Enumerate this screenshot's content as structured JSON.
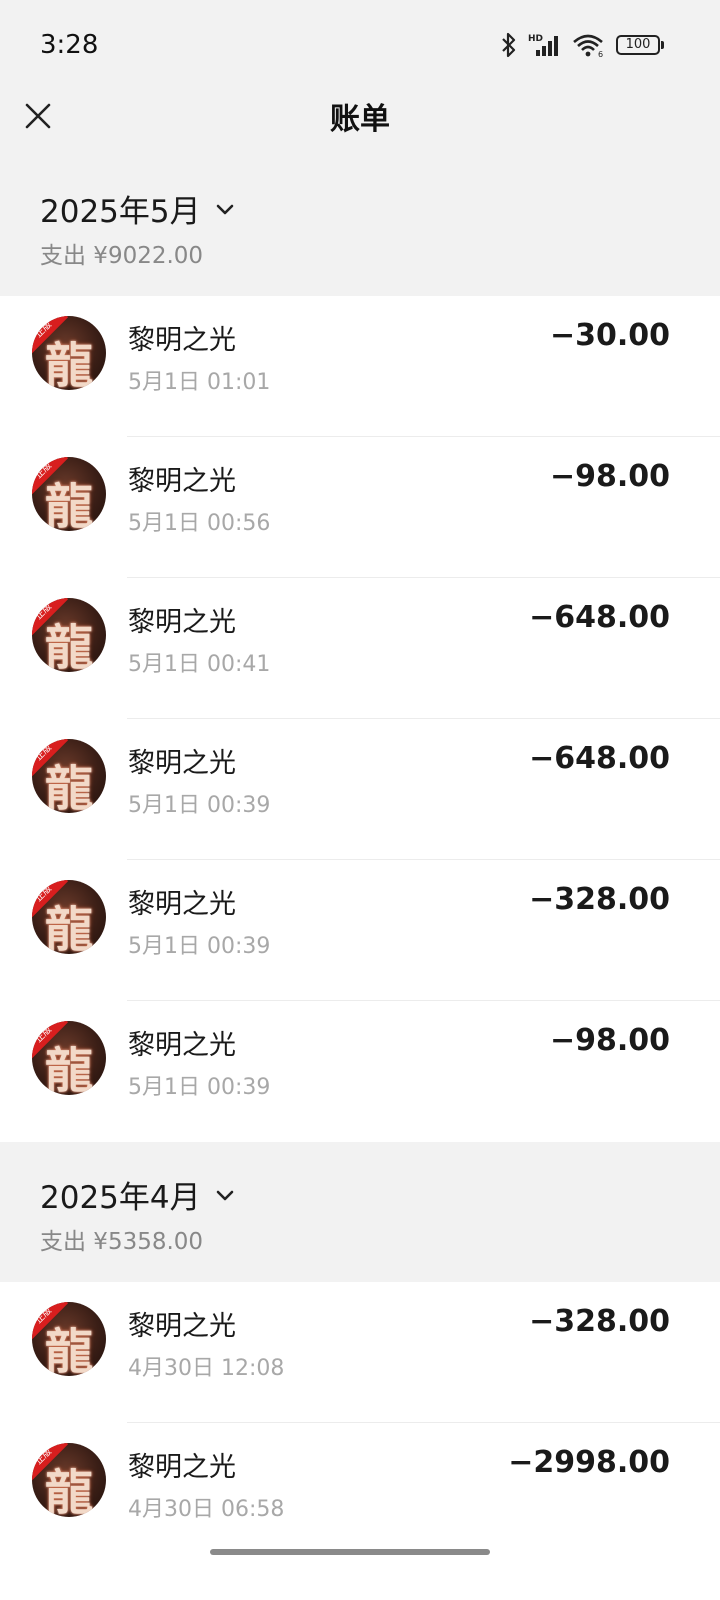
{
  "status_bar": {
    "time": "3:28",
    "battery": "100",
    "icons": [
      "bluetooth-icon",
      "hd-signal-icon",
      "wifi-icon",
      "battery-icon"
    ]
  },
  "header": {
    "title": "账单",
    "close_icon": "close-icon"
  },
  "groups": [
    {
      "month": "2025年5月",
      "summary": "支出 ¥9022.00",
      "items": [
        {
          "name": "黎明之光",
          "time": "5月1日 01:01",
          "amount": "−30.00"
        },
        {
          "name": "黎明之光",
          "time": "5月1日 00:56",
          "amount": "−98.00"
        },
        {
          "name": "黎明之光",
          "time": "5月1日 00:41",
          "amount": "−648.00"
        },
        {
          "name": "黎明之光",
          "time": "5月1日 00:39",
          "amount": "−648.00"
        },
        {
          "name": "黎明之光",
          "time": "5月1日 00:39",
          "amount": "−328.00"
        },
        {
          "name": "黎明之光",
          "time": "5月1日 00:39",
          "amount": "−98.00"
        }
      ]
    },
    {
      "month": "2025年4月",
      "summary": "支出 ¥5358.00",
      "items": [
        {
          "name": "黎明之光",
          "time": "4月30日 12:08",
          "amount": "−328.00"
        },
        {
          "name": "黎明之光",
          "time": "4月30日 06:58",
          "amount": "−2998.00"
        }
      ]
    }
  ],
  "app_icon": {
    "glyph": "龍",
    "badge": "正版"
  },
  "colors": {
    "header_bg": "#f2f2f2",
    "secondary_text": "#a8a8a8",
    "badge_red": "#d81e1e"
  }
}
